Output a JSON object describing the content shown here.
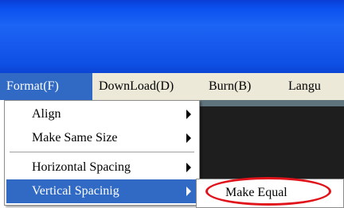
{
  "menubar": {
    "items": [
      {
        "label": "Format(F)",
        "active": true
      },
      {
        "label": "DownLoad(D)",
        "active": false
      },
      {
        "label": "Burn(B)",
        "active": false
      },
      {
        "label": "Langu",
        "active": false
      }
    ]
  },
  "format_menu": {
    "items": [
      {
        "label": "Align",
        "has_submenu": true
      },
      {
        "label": "Make Same Size",
        "has_submenu": true
      },
      {
        "label": "Horizontal Spacing",
        "has_submenu": true
      },
      {
        "label": "Vertical Spacinig",
        "has_submenu": true,
        "highlighted": true
      }
    ]
  },
  "vertical_spacing_submenu": {
    "items": [
      {
        "label": "Make Equal"
      }
    ]
  },
  "colors": {
    "titlebar": "#1c64f4",
    "menubar": "#ece9d8",
    "highlight": "#316ac5",
    "annotation_ring": "#e0121a"
  }
}
